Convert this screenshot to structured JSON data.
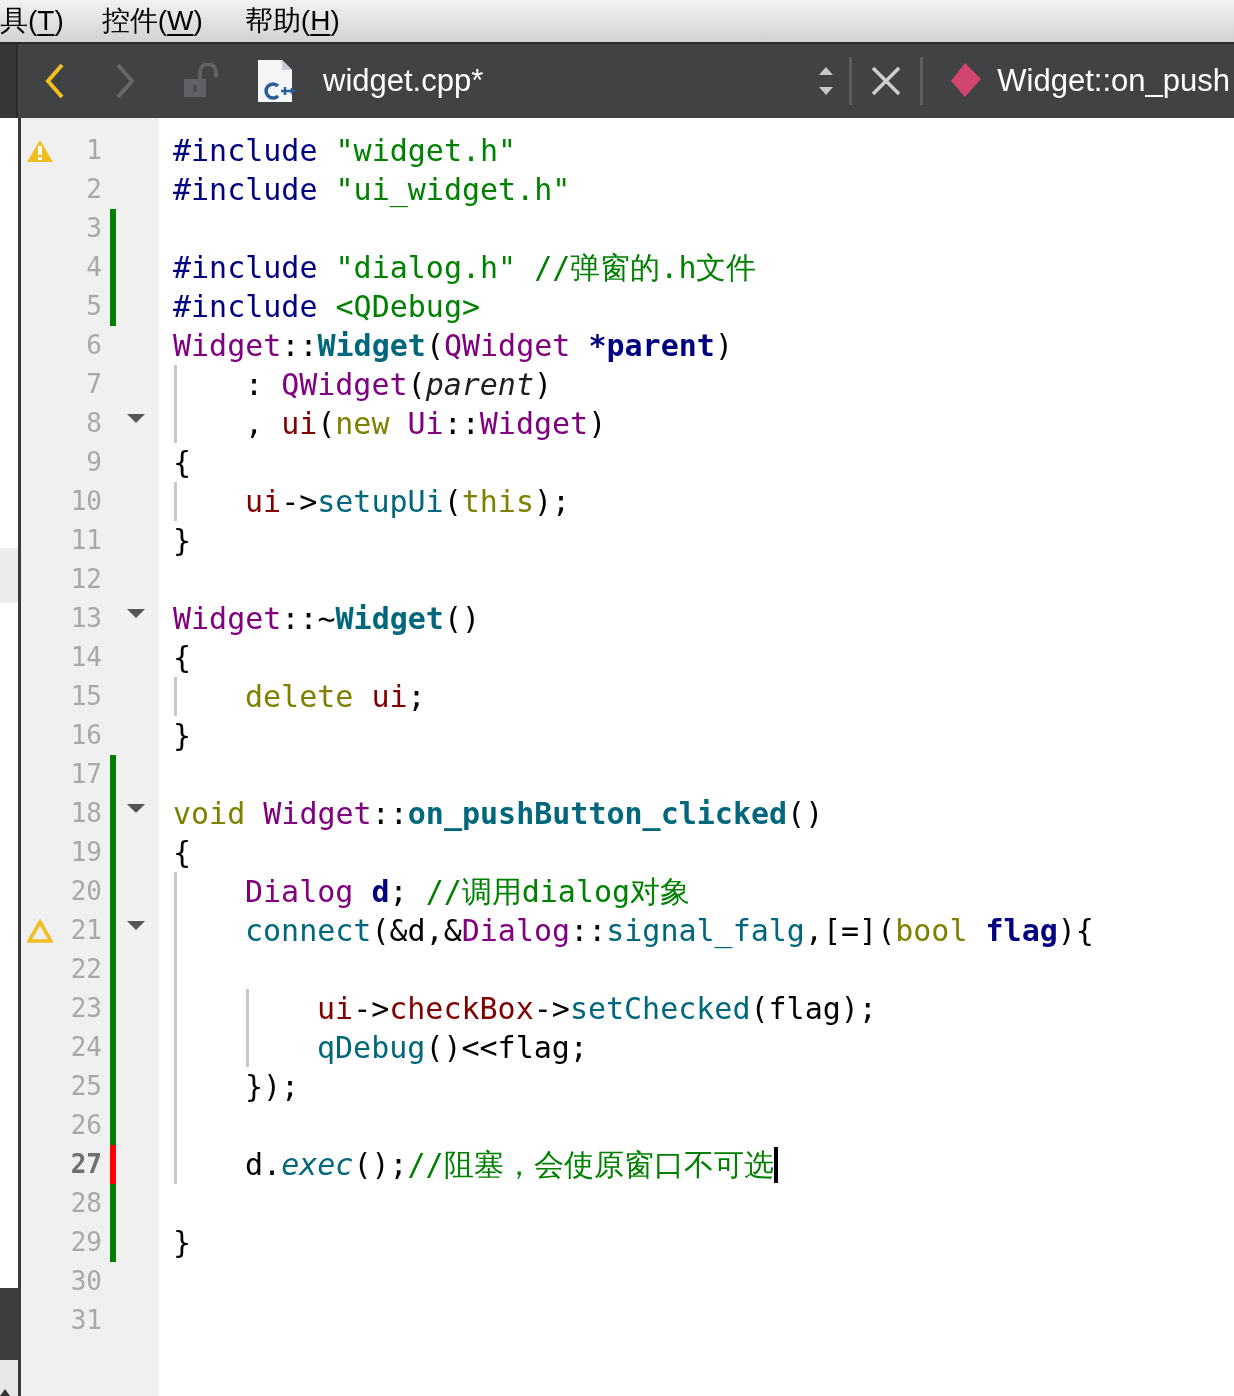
{
  "menu": [
    {
      "before": "具(",
      "mnemonic": "T",
      "after": ")"
    },
    {
      "before": "控件(",
      "mnemonic": "W",
      "after": ")"
    },
    {
      "before": "帮助(",
      "mnemonic": "H",
      "after": ")"
    }
  ],
  "toolbar": {
    "back": {
      "disabled": false
    },
    "forward": {
      "disabled": true
    },
    "file": "widget.cpp*",
    "symbol": "Widget::on_push"
  },
  "lines": [
    {
      "number": "1",
      "warning": {
        "kind": "filled"
      },
      "added": false,
      "modified": false,
      "fold": false,
      "current": false,
      "tokens": [
        {
          "t": "#include ",
          "kind": "pre"
        },
        {
          "t": "\"widget.h\"",
          "kind": "str"
        }
      ]
    },
    {
      "number": "2",
      "added": false,
      "modified": false,
      "fold": false,
      "current": false,
      "tokens": [
        {
          "t": "#include ",
          "kind": "pre"
        },
        {
          "t": "\"ui_widget.h\"",
          "kind": "str"
        }
      ]
    },
    {
      "number": "3",
      "added": true,
      "modified": false,
      "fold": false,
      "current": false
    },
    {
      "number": "4",
      "added": true,
      "modified": false,
      "fold": false,
      "current": false,
      "tokens": [
        {
          "t": "#include ",
          "kind": "pre"
        },
        {
          "t": "\"dialog.h\" ",
          "kind": "str"
        },
        {
          "t": "//弹窗的.h文件",
          "kind": "comment"
        }
      ]
    },
    {
      "number": "5",
      "added": true,
      "modified": false,
      "fold": false,
      "current": false,
      "tokens": [
        {
          "t": "#include ",
          "kind": "pre"
        },
        {
          "t": "<QDebug>",
          "kind": "str"
        }
      ]
    },
    {
      "number": "6",
      "added": false,
      "modified": false,
      "fold": false,
      "current": false,
      "tokens": [
        {
          "t": "Widget",
          "kind": "type"
        },
        {
          "t": "::",
          "kind": "plain"
        },
        {
          "t": "Widget",
          "kind": "decl"
        },
        {
          "t": "(",
          "kind": "plain"
        },
        {
          "t": "QWidget ",
          "kind": "type"
        },
        {
          "t": "*parent",
          "kind": "param"
        },
        {
          "t": ")",
          "kind": "plain"
        }
      ]
    },
    {
      "number": "7",
      "added": false,
      "modified": false,
      "fold": false,
      "current": false,
      "indent": [
        {
          "guide": true
        }
      ],
      "tokens": [
        {
          "t": ": ",
          "kind": "plain"
        },
        {
          "t": "QWidget",
          "kind": "type"
        },
        {
          "t": "(",
          "kind": "plain"
        },
        {
          "t": "parent",
          "kind": "italic"
        },
        {
          "t": ")",
          "kind": "plain"
        }
      ]
    },
    {
      "number": "8",
      "added": false,
      "modified": false,
      "fold": true,
      "current": false,
      "indent": [
        {
          "guide": true
        }
      ],
      "tokens": [
        {
          "t": ", ",
          "kind": "plain"
        },
        {
          "t": "ui",
          "kind": "member"
        },
        {
          "t": "(",
          "kind": "plain"
        },
        {
          "t": "new ",
          "kind": "kw"
        },
        {
          "t": "Ui",
          "kind": "type"
        },
        {
          "t": "::",
          "kind": "plain"
        },
        {
          "t": "Widget",
          "kind": "type"
        },
        {
          "t": ")",
          "kind": "plain"
        }
      ]
    },
    {
      "number": "9",
      "added": false,
      "modified": false,
      "fold": false,
      "current": false,
      "tokens": [
        {
          "t": "{",
          "kind": "plain"
        }
      ]
    },
    {
      "number": "10",
      "added": false,
      "modified": false,
      "fold": false,
      "current": false,
      "indent": [
        {
          "guide": true
        }
      ],
      "tokens": [
        {
          "t": "ui",
          "kind": "member"
        },
        {
          "t": "->",
          "kind": "plain"
        },
        {
          "t": "setupUi",
          "kind": "fn"
        },
        {
          "t": "(",
          "kind": "plain"
        },
        {
          "t": "this",
          "kind": "kw"
        },
        {
          "t": ");",
          "kind": "plain"
        }
      ]
    },
    {
      "number": "11",
      "added": false,
      "modified": false,
      "fold": false,
      "current": false,
      "tokens": [
        {
          "t": "}",
          "kind": "plain"
        }
      ]
    },
    {
      "number": "12",
      "added": false,
      "modified": false,
      "fold": false,
      "current": false
    },
    {
      "number": "13",
      "added": false,
      "modified": false,
      "fold": true,
      "current": false,
      "tokens": [
        {
          "t": "Widget",
          "kind": "type"
        },
        {
          "t": "::~",
          "kind": "plain"
        },
        {
          "t": "Widget",
          "kind": "decl"
        },
        {
          "t": "()",
          "kind": "plain"
        }
      ]
    },
    {
      "number": "14",
      "added": false,
      "modified": false,
      "fold": false,
      "current": false,
      "tokens": [
        {
          "t": "{",
          "kind": "plain"
        }
      ]
    },
    {
      "number": "15",
      "added": false,
      "modified": false,
      "fold": false,
      "current": false,
      "indent": [
        {
          "guide": true
        }
      ],
      "tokens": [
        {
          "t": "delete ",
          "kind": "kw"
        },
        {
          "t": "ui",
          "kind": "member"
        },
        {
          "t": ";",
          "kind": "plain"
        }
      ]
    },
    {
      "number": "16",
      "added": false,
      "modified": false,
      "fold": false,
      "current": false,
      "tokens": [
        {
          "t": "}",
          "kind": "plain"
        }
      ]
    },
    {
      "number": "17",
      "added": true,
      "modified": false,
      "fold": false,
      "current": false
    },
    {
      "number": "18",
      "added": true,
      "modified": false,
      "fold": true,
      "current": false,
      "tokens": [
        {
          "t": "void ",
          "kind": "kw"
        },
        {
          "t": "Widget",
          "kind": "type"
        },
        {
          "t": "::",
          "kind": "plain"
        },
        {
          "t": "on_pushButton_clicked",
          "kind": "decl"
        },
        {
          "t": "()",
          "kind": "plain"
        }
      ]
    },
    {
      "number": "19",
      "added": true,
      "modified": false,
      "fold": false,
      "current": false,
      "tokens": [
        {
          "t": "{",
          "kind": "plain"
        }
      ]
    },
    {
      "number": "20",
      "added": true,
      "modified": false,
      "fold": false,
      "current": false,
      "indent": [
        {
          "guide": true
        }
      ],
      "tokens": [
        {
          "t": "Dialog ",
          "kind": "type"
        },
        {
          "t": "d",
          "kind": "param"
        },
        {
          "t": "; ",
          "kind": "plain"
        },
        {
          "t": "//调用dialog对象",
          "kind": "comment"
        }
      ]
    },
    {
      "number": "21",
      "warning": {
        "kind": "outline"
      },
      "added": true,
      "modified": false,
      "fold": true,
      "current": false,
      "indent": [
        {
          "guide": true
        }
      ],
      "tokens": [
        {
          "t": "connect",
          "kind": "fn"
        },
        {
          "t": "(&d,&",
          "kind": "plain"
        },
        {
          "t": "Dialog",
          "kind": "type"
        },
        {
          "t": "::",
          "kind": "plain"
        },
        {
          "t": "signal_falg",
          "kind": "fn"
        },
        {
          "t": ",[=](",
          "kind": "plain"
        },
        {
          "t": "bool ",
          "kind": "kw"
        },
        {
          "t": "flag",
          "kind": "param"
        },
        {
          "t": "){",
          "kind": "plain"
        }
      ]
    },
    {
      "number": "22",
      "added": true,
      "modified": false,
      "fold": false,
      "current": false,
      "indent": [
        {
          "guide": true
        }
      ]
    },
    {
      "number": "23",
      "added": true,
      "modified": false,
      "fold": false,
      "current": false,
      "indent": [
        {
          "guide": true
        },
        {
          "guide": true
        }
      ],
      "tokens": [
        {
          "t": "ui",
          "kind": "member"
        },
        {
          "t": "->",
          "kind": "plain"
        },
        {
          "t": "checkBox",
          "kind": "member"
        },
        {
          "t": "->",
          "kind": "plain"
        },
        {
          "t": "setChecked",
          "kind": "fn"
        },
        {
          "t": "(flag);",
          "kind": "plain"
        }
      ]
    },
    {
      "number": "24",
      "added": true,
      "modified": false,
      "fold": false,
      "current": false,
      "indent": [
        {
          "guide": true
        },
        {
          "guide": true
        }
      ],
      "tokens": [
        {
          "t": "qDebug",
          "kind": "fn"
        },
        {
          "t": "()<<flag;",
          "kind": "plain"
        }
      ]
    },
    {
      "number": "25",
      "added": true,
      "modified": false,
      "fold": false,
      "current": false,
      "indent": [
        {
          "guide": true
        }
      ],
      "tokens": [
        {
          "t": "});",
          "kind": "plain"
        }
      ]
    },
    {
      "number": "26",
      "added": true,
      "modified": false,
      "fold": false,
      "current": false,
      "indent": [
        {
          "guide": true
        }
      ]
    },
    {
      "number": "27",
      "added": false,
      "modified": true,
      "fold": false,
      "current": true,
      "indent": [
        {
          "guide": true
        }
      ],
      "tokens": [
        {
          "t": "d.",
          "kind": "plain"
        },
        {
          "t": "exec",
          "kind": "fn-italic"
        },
        {
          "t": "();",
          "kind": "plain"
        },
        {
          "t": "//阻塞，会使原窗口不可选",
          "kind": "comment"
        }
      ]
    },
    {
      "number": "28",
      "added": true,
      "modified": false,
      "fold": false,
      "current": false
    },
    {
      "number": "29",
      "added": true,
      "modified": false,
      "fold": false,
      "current": false,
      "tokens": [
        {
          "t": "}",
          "kind": "plain"
        }
      ]
    },
    {
      "number": "30",
      "added": false,
      "modified": false,
      "fold": false,
      "current": false
    },
    {
      "number": "31",
      "added": false,
      "modified": false,
      "fold": false,
      "current": false
    }
  ]
}
